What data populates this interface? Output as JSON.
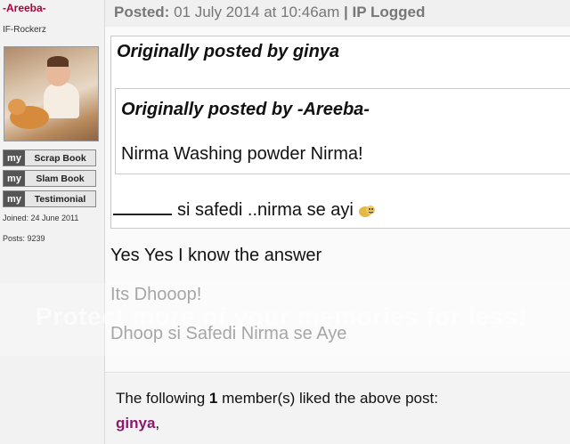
{
  "user": {
    "name": "-Areeba-",
    "title": "IF-Rockerz",
    "joined": "Joined: 24 June 2011",
    "posts": "Posts: 9239",
    "badges": [
      {
        "prefix": "my",
        "label": "Scrap Book"
      },
      {
        "prefix": "my",
        "label": "Slam Book"
      },
      {
        "prefix": "my",
        "label": "Testimonial"
      }
    ]
  },
  "post": {
    "posted_label": "Posted:",
    "posted_date": "01 July 2014 at 10:46am",
    "separator": "|",
    "ip_logged": "IP Logged",
    "outer_quote_header": "Originally posted by ginya",
    "inner_quote_header": "Originally posted by -Areeba-",
    "inner_quote_text": "Nirma Washing powder Nirma!",
    "outer_quote_text": "si safedi ..nirma se ayi",
    "reply_lines": [
      "Yes Yes I know the answer",
      "Its Dhooop!",
      "Dhoop si Safedi Nirma se Aye"
    ]
  },
  "watermark": "Protect more of your memories for less!",
  "likes": {
    "prefix": "The following",
    "count": "1",
    "suffix": "member(s) liked the above post:",
    "users": [
      "ginya"
    ],
    "separator": ","
  }
}
